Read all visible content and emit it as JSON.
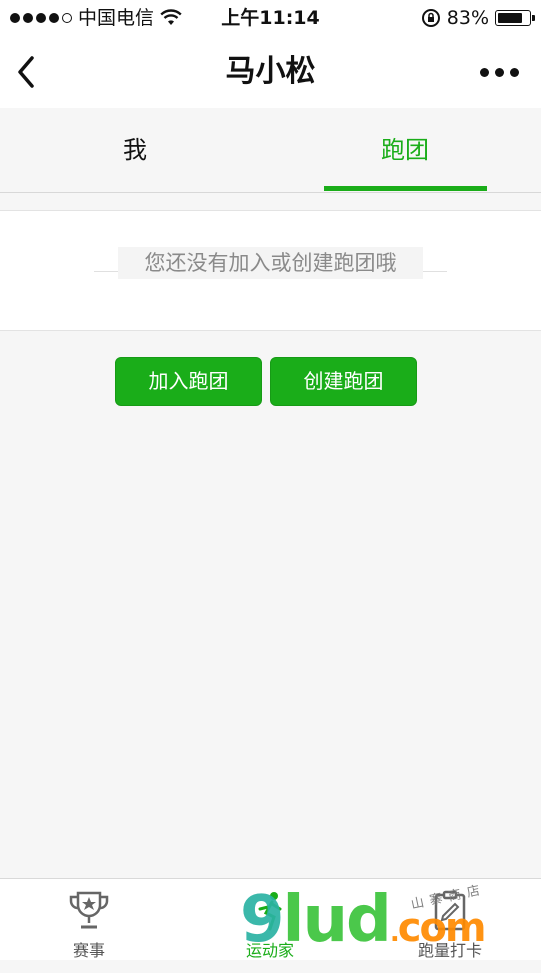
{
  "status_bar": {
    "carrier": "中国电信",
    "time": "上午11:14",
    "battery": "83%",
    "battery_level": 0.83
  },
  "nav": {
    "title": "马小松",
    "back_icon": "chevron-left-icon",
    "more_icon": "more-icon"
  },
  "tabs": [
    {
      "label": "我",
      "active": false
    },
    {
      "label": "跑团",
      "active": true
    }
  ],
  "empty_notice": "您还没有加入或创建跑团哦",
  "buttons": {
    "join": "加入跑团",
    "create": "创建跑团"
  },
  "tab_bar": [
    {
      "label": "赛事",
      "icon": "trophy-icon"
    },
    {
      "label": "运动家",
      "icon": "runner-icon",
      "active": true
    },
    {
      "label": "跑量打卡",
      "icon": "clipboard-icon"
    }
  ],
  "watermark": {
    "text_9": "9",
    "text_lud": "lud",
    "text_dot": ".",
    "text_com": "com",
    "handwriting": "山寨商店"
  },
  "colors": {
    "accent": "#1aad19",
    "background": "#f6f6f6"
  }
}
